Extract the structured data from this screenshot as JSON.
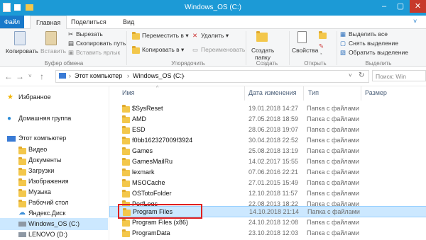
{
  "window": {
    "title": "Windows_OS (C:)"
  },
  "tabs": [
    "Файл",
    "Главная",
    "Поделиться",
    "Вид"
  ],
  "ribbon": {
    "clipboard": {
      "copy": "Копировать",
      "paste": "Вставить",
      "cut": "Вырезать",
      "copy_path": "Скопировать путь",
      "paste_shortcut": "Вставить ярлык",
      "label": "Буфер обмена"
    },
    "organize": {
      "move_to": "Переместить в ▾",
      "copy_to": "Копировать в ▾",
      "delete": "Удалить ▾",
      "rename": "Переименовать",
      "label": "Упорядочить"
    },
    "new": {
      "new_folder": "Создать",
      "new_folder2": "папку",
      "label": "Создать"
    },
    "open": {
      "properties": "Свойства",
      "label": "Открыть"
    },
    "select": {
      "select_all": "Выделить все",
      "select_none": "Снять выделение",
      "invert": "Обратить выделение",
      "label": "Выделить"
    }
  },
  "address": {
    "path_pc": "Этот компьютер",
    "path_drive": "Windows_OS (C:)",
    "search_placeholder": "Поиск: Win"
  },
  "nav": {
    "favorites": "Избранное",
    "homegroup": "Домашняя группа",
    "this_pc": "Этот компьютер",
    "items": [
      "Видео",
      "Документы",
      "Загрузки",
      "Изображения",
      "Музыка",
      "Рабочий стол",
      "Яндекс.Диск",
      "Windows_OS (C:)",
      "LENOVO (D:)"
    ]
  },
  "columns": {
    "name": "Имя",
    "date": "Дата изменения",
    "type": "Тип",
    "size": "Размер"
  },
  "files": [
    {
      "name": "$SysReset",
      "date": "19.01.2018 14:27",
      "type": "Папка с файлами"
    },
    {
      "name": "AMD",
      "date": "27.05.2018 18:59",
      "type": "Папка с файлами"
    },
    {
      "name": "ESD",
      "date": "28.06.2018 19:07",
      "type": "Папка с файлами"
    },
    {
      "name": "f0bb162327009f3924",
      "date": "30.04.2018 22:52",
      "type": "Папка с файлами"
    },
    {
      "name": "Games",
      "date": "25.08.2018 13:19",
      "type": "Папка с файлами"
    },
    {
      "name": "GamesMailRu",
      "date": "14.02.2017 15:55",
      "type": "Папка с файлами"
    },
    {
      "name": "lexmark",
      "date": "07.06.2016 22:21",
      "type": "Папка с файлами"
    },
    {
      "name": "MSOCache",
      "date": "27.01.2015 15:49",
      "type": "Папка с файлами"
    },
    {
      "name": "OSTotoFolder",
      "date": "12.10.2018 11:57",
      "type": "Папка с файлами"
    },
    {
      "name": "PerfLogs",
      "date": "22.08.2013 18:22",
      "type": "Папка с файлами"
    },
    {
      "name": "Program Files",
      "date": "14.10.2018 21:14",
      "type": "Папка с файлами"
    },
    {
      "name": "Program Files (x86)",
      "date": "24.10.2018 12:08",
      "type": "Папка с файлами"
    },
    {
      "name": "ProgramData",
      "date": "23.10.2018 12:03",
      "type": "Папка с файлами"
    }
  ],
  "colors": {
    "titlebar": "#1c9ad6",
    "file_tab": "#1979ca",
    "selection": "#cce8ff",
    "highlight": "#e02020"
  }
}
